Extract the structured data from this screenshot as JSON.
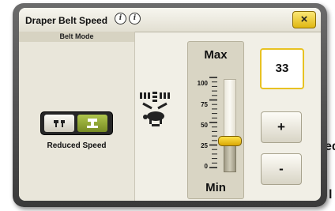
{
  "background": {
    "partial_text_1": "ed",
    "partial_text_2": "l"
  },
  "dialog": {
    "title": "Draper Belt Speed",
    "info_icons": [
      "info-icon",
      "info-icon"
    ],
    "close_label": "×"
  },
  "belt_mode": {
    "header": "Belt Mode",
    "options": [
      {
        "name": "normal-speed",
        "icon": "belt-normal-icon",
        "selected": false
      },
      {
        "name": "reduced-speed",
        "icon": "belt-reduced-icon",
        "selected": true
      }
    ],
    "selected_label": "Reduced Speed"
  },
  "slider": {
    "max_label": "Max",
    "min_label": "Min",
    "ticks": [
      "100",
      "75",
      "50",
      "25",
      "0"
    ],
    "level_percent": 33
  },
  "value_display": "33",
  "buttons": {
    "increase": "+",
    "decrease": "-"
  },
  "colors": {
    "accent_yellow": "#f2cf26",
    "active_green": "#8fa636",
    "frame_dark": "#4a4a4a",
    "panel": "#f1efe6"
  }
}
